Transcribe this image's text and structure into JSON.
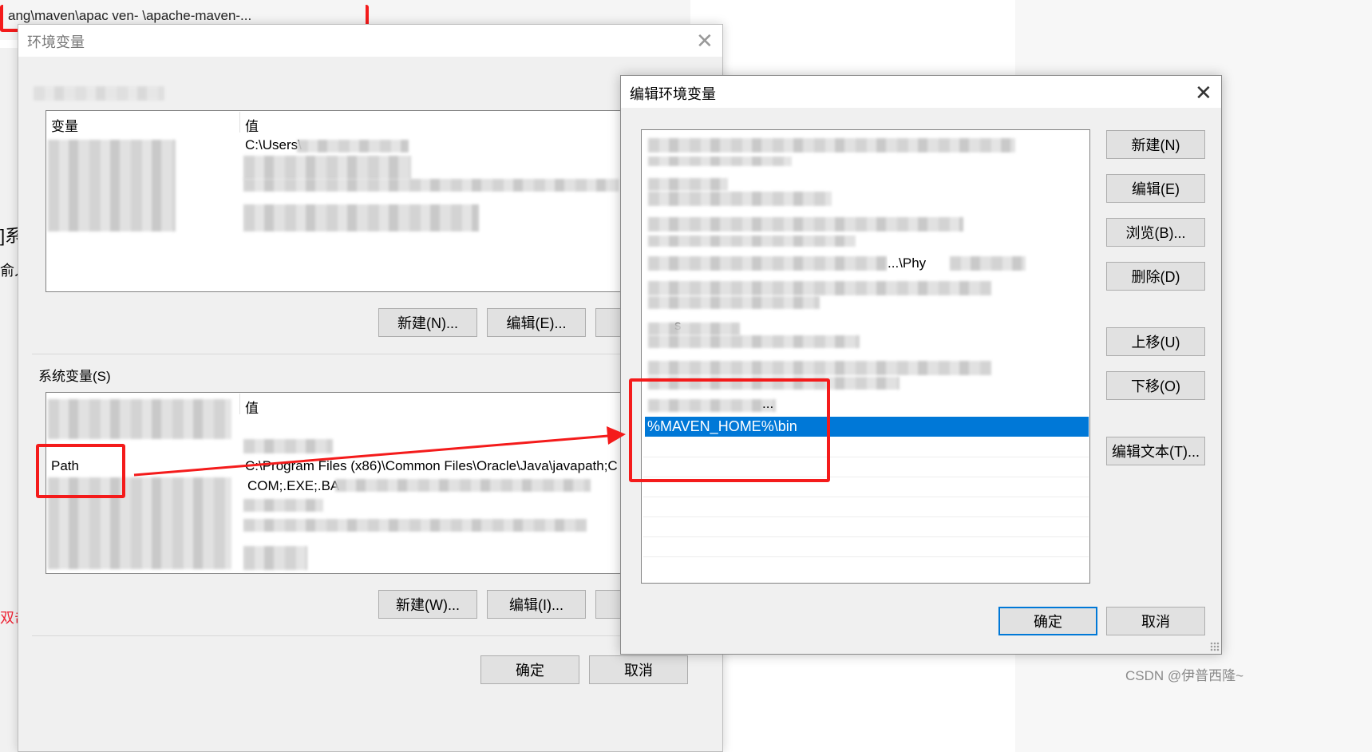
{
  "background": {
    "path_fragment": "ang\\maven\\apac      ven-          \\apache-maven-...",
    "left_text_1": "]系",
    "left_text_2": "俞入",
    "left_text_3": "双击"
  },
  "env_dialog": {
    "title": "环境变量",
    "user_vars": {
      "col_name": "变量",
      "col_value": "值",
      "first_value": "C:\\Users\\",
      "new_button": "新建(N)...",
      "edit_button": "编辑(E)..."
    },
    "system_vars": {
      "section_label": "系统变量(S)",
      "col_value": "值",
      "path_name": "Path",
      "path_value": "C:\\Program Files (x86)\\Common Files\\Oracle\\Java\\javapath;C",
      "pathext_value": "COM;.EXE;.BA",
      "new_button": "新建(W)...",
      "edit_button": "编辑(I)..."
    },
    "ok_button": "确定",
    "cancel_button": "取消"
  },
  "edit_dialog": {
    "title": "编辑环境变量",
    "selected_entry": "%MAVEN_HOME%\\bin",
    "partial_entry_1": "...\\Phy",
    "partial_entry_2": "s",
    "partial_entry_3": "...",
    "buttons": {
      "new": "新建(N)",
      "edit": "编辑(E)",
      "browse": "浏览(B)...",
      "delete": "删除(D)",
      "move_up": "上移(U)",
      "move_down": "下移(O)",
      "edit_text": "编辑文本(T)..."
    },
    "ok_button": "确定",
    "cancel_button": "取消"
  },
  "watermark": "CSDN @伊普西隆~",
  "colors": {
    "selection": "#0078d7",
    "annotation_red": "#f41b1b",
    "button_face": "#e1e1e1"
  }
}
